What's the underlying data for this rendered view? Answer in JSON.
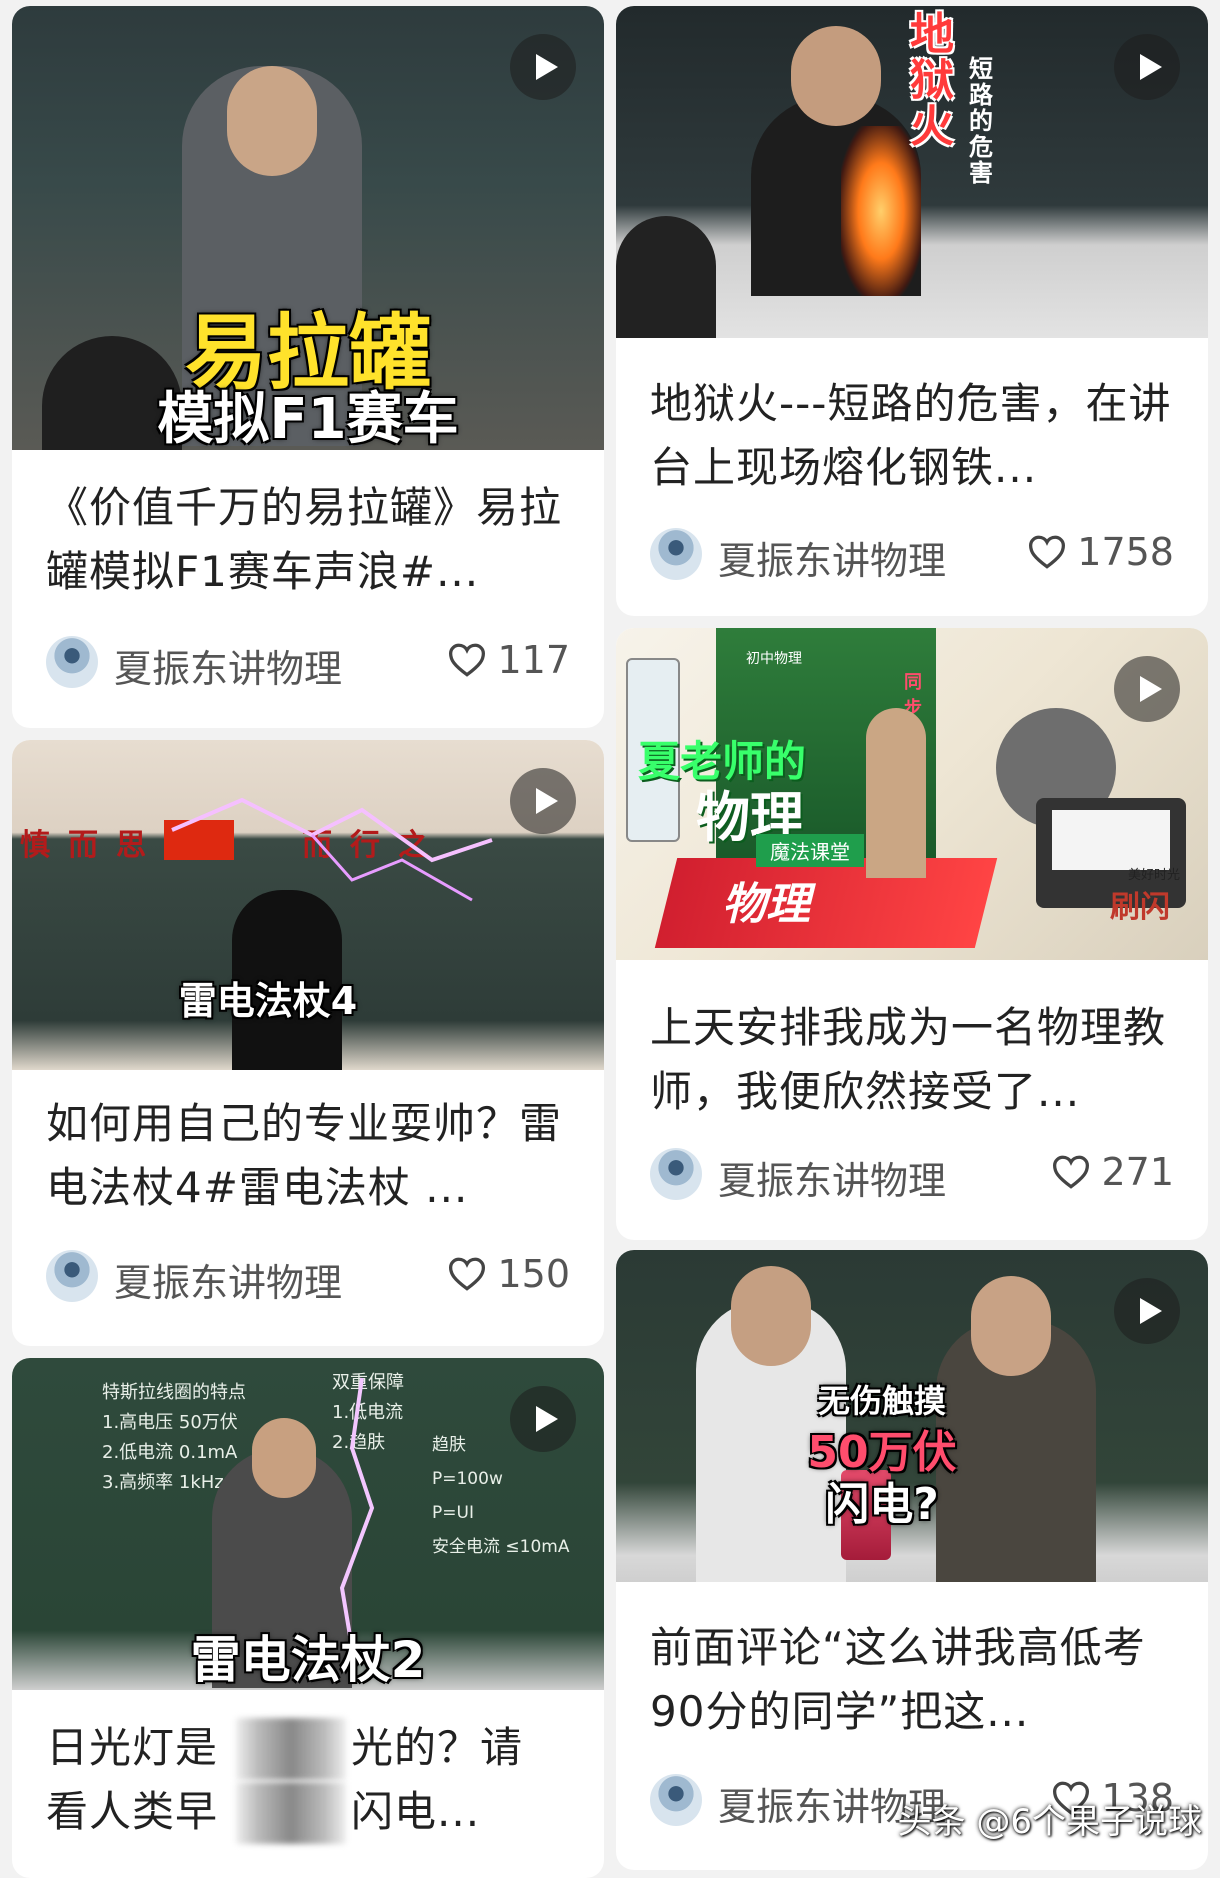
{
  "cards": [
    {
      "overlay1": "易拉罐",
      "overlay2": "模拟F1赛车",
      "title": "《价值千万的易拉罐》易拉罐模拟F1赛车声浪#...",
      "author": "夏振东讲物理",
      "likes": "117"
    },
    {
      "overlay1": "地狱火",
      "overlay2": "短路的危害",
      "title": "地狱火---短路的危害，在讲台上现场熔化钢铁...",
      "author": "夏振东讲物理",
      "likes": "1758"
    },
    {
      "banner": [
        "慎",
        "而",
        "思",
        "而",
        "行",
        "之"
      ],
      "overlay1": "雷电法杖4",
      "title": "如何用自己的专业耍帅？雷电法杖4#雷电法杖 ...",
      "author": "夏振东讲物理",
      "likes": "150"
    },
    {
      "book_label": "初中物理",
      "book_side": "同步练习",
      "overlay1": "夏老师的",
      "overlay2": "物理",
      "overlay3": "魔法课堂",
      "book_title": "物理",
      "corner_small": "美好时光",
      "corner_label": "刷闪",
      "title": "上天安排我成为一名物理教师，我便欣然接受了...",
      "author": "夏振东讲物理",
      "likes": "271"
    },
    {
      "board_text": [
        "特斯拉线圈的特点",
        "1.高电压 50万伏",
        "2.低电流 0.1mA",
        "3.高频率 1kHz",
        "双重保障",
        "1.低电流",
        "2.趋肤",
        "趋肤",
        "P=100w",
        "P=UI",
        "安全电流 ≤10mA"
      ],
      "overlay1": "雷电法杖2",
      "title_part1": "日光灯是",
      "title_part2": "光的？请",
      "title_part3": "看人类早",
      "title_part4": "闪电...",
      "author": "夏振东讲物理",
      "likes": ""
    },
    {
      "overlay1": "无伤触摸",
      "overlay2": "50万伏",
      "overlay3": "闪电?",
      "title": "前面评论“这么讲我高低考90分的同学”把这...",
      "author": "夏振东讲物理",
      "likes": "138"
    }
  ],
  "watermark": "头条 @6个果子说球"
}
